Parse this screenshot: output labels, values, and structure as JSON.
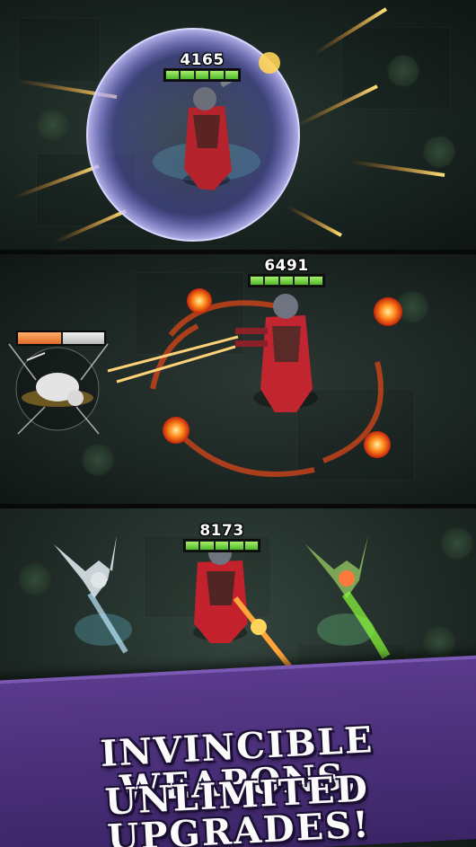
{
  "panels": [
    {
      "hp": "4165",
      "hp_fraction": 1.0
    },
    {
      "hp": "6491",
      "hp_fraction": 1.0,
      "enemy_hp_fraction": 0.5
    },
    {
      "hp": "8173",
      "hp_fraction": 1.0
    }
  ],
  "banner": {
    "line1": "INVINCIBLE WEAPONS,",
    "line2": "UNLIMITED UPGRADES!"
  },
  "colors": {
    "hp_green": "#6fd63d",
    "banner_purple": "#4a2f7a",
    "shield_blue": "#7d78ff",
    "fire_orange": "#ff7a1a"
  },
  "icons": [
    "hero-gunslinger",
    "energy-shield",
    "rat-enemy",
    "bat-familiar-ghost",
    "bat-familiar-poison",
    "fireball",
    "bullet-tracer"
  ]
}
